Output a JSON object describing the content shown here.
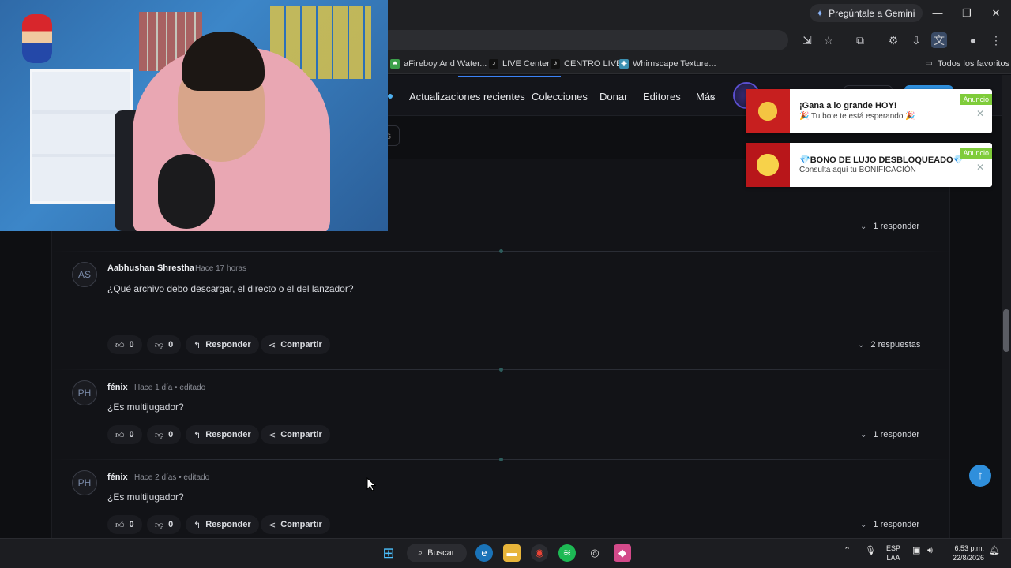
{
  "browser": {
    "gemini_label": "Pregúntale a Gemini",
    "bookmarks": [
      {
        "label": "aFireboy And Water...",
        "icon": "game-icon"
      },
      {
        "label": "LIVE Center",
        "icon": "tiktok-icon"
      },
      {
        "label": "CENTRO LIVE",
        "icon": "tiktok-icon"
      },
      {
        "label": "Whimscape Texture...",
        "icon": "cube-icon"
      }
    ],
    "all_bookmarks": "Todos los favoritos"
  },
  "site_nav": {
    "links": [
      "Actualizaciones recientes",
      "Colecciones",
      "Donar",
      "Editores",
      "Más"
    ],
    "search_placeholder": "s"
  },
  "ads": [
    {
      "title": "¡Gana a lo grande HOY!",
      "subtitle": "🎉 Tu bote te está esperando 🎉",
      "tag": "Anuncio"
    },
    {
      "title": "💎BONO DE LUJO DESBLOQUEADO💎",
      "subtitle": "Consulta aquí tu BONIFICACIÓN",
      "tag": "Anuncio"
    }
  ],
  "top_replies": "1 responder",
  "comments": [
    {
      "initials": "AS",
      "author": "Aabhushan Shrestha",
      "time": "Hace 17 horas",
      "text": "¿Qué archivo debo descargar, el directo o el del lanzador?",
      "likes": "0",
      "dislikes": "0",
      "reply_label": "Responder",
      "share_label": "Compartir",
      "replies": "2 respuestas"
    },
    {
      "initials": "PH",
      "author": "fénix",
      "time": "Hace 1 día • editado",
      "text": "¿Es multijugador?",
      "likes": "0",
      "dislikes": "0",
      "reply_label": "Responder",
      "share_label": "Compartir",
      "replies": "1 responder"
    },
    {
      "initials": "PH",
      "author": "fénix",
      "time": "Hace 2 días • editado",
      "text": "¿Es multijugador?",
      "likes": "0",
      "dislikes": "0",
      "reply_label": "Responder",
      "share_label": "Compartir",
      "replies": "1 responder"
    }
  ],
  "taskbar": {
    "search_label": "Buscar",
    "lang": "ESP",
    "lang2": "LAA",
    "time": "6:53 p.m.",
    "date": "22/8/2026"
  },
  "colors": {
    "accent": "#2f8fdc",
    "page_bg": "#0e0f12",
    "ad_tag": "#7fcc3a"
  }
}
